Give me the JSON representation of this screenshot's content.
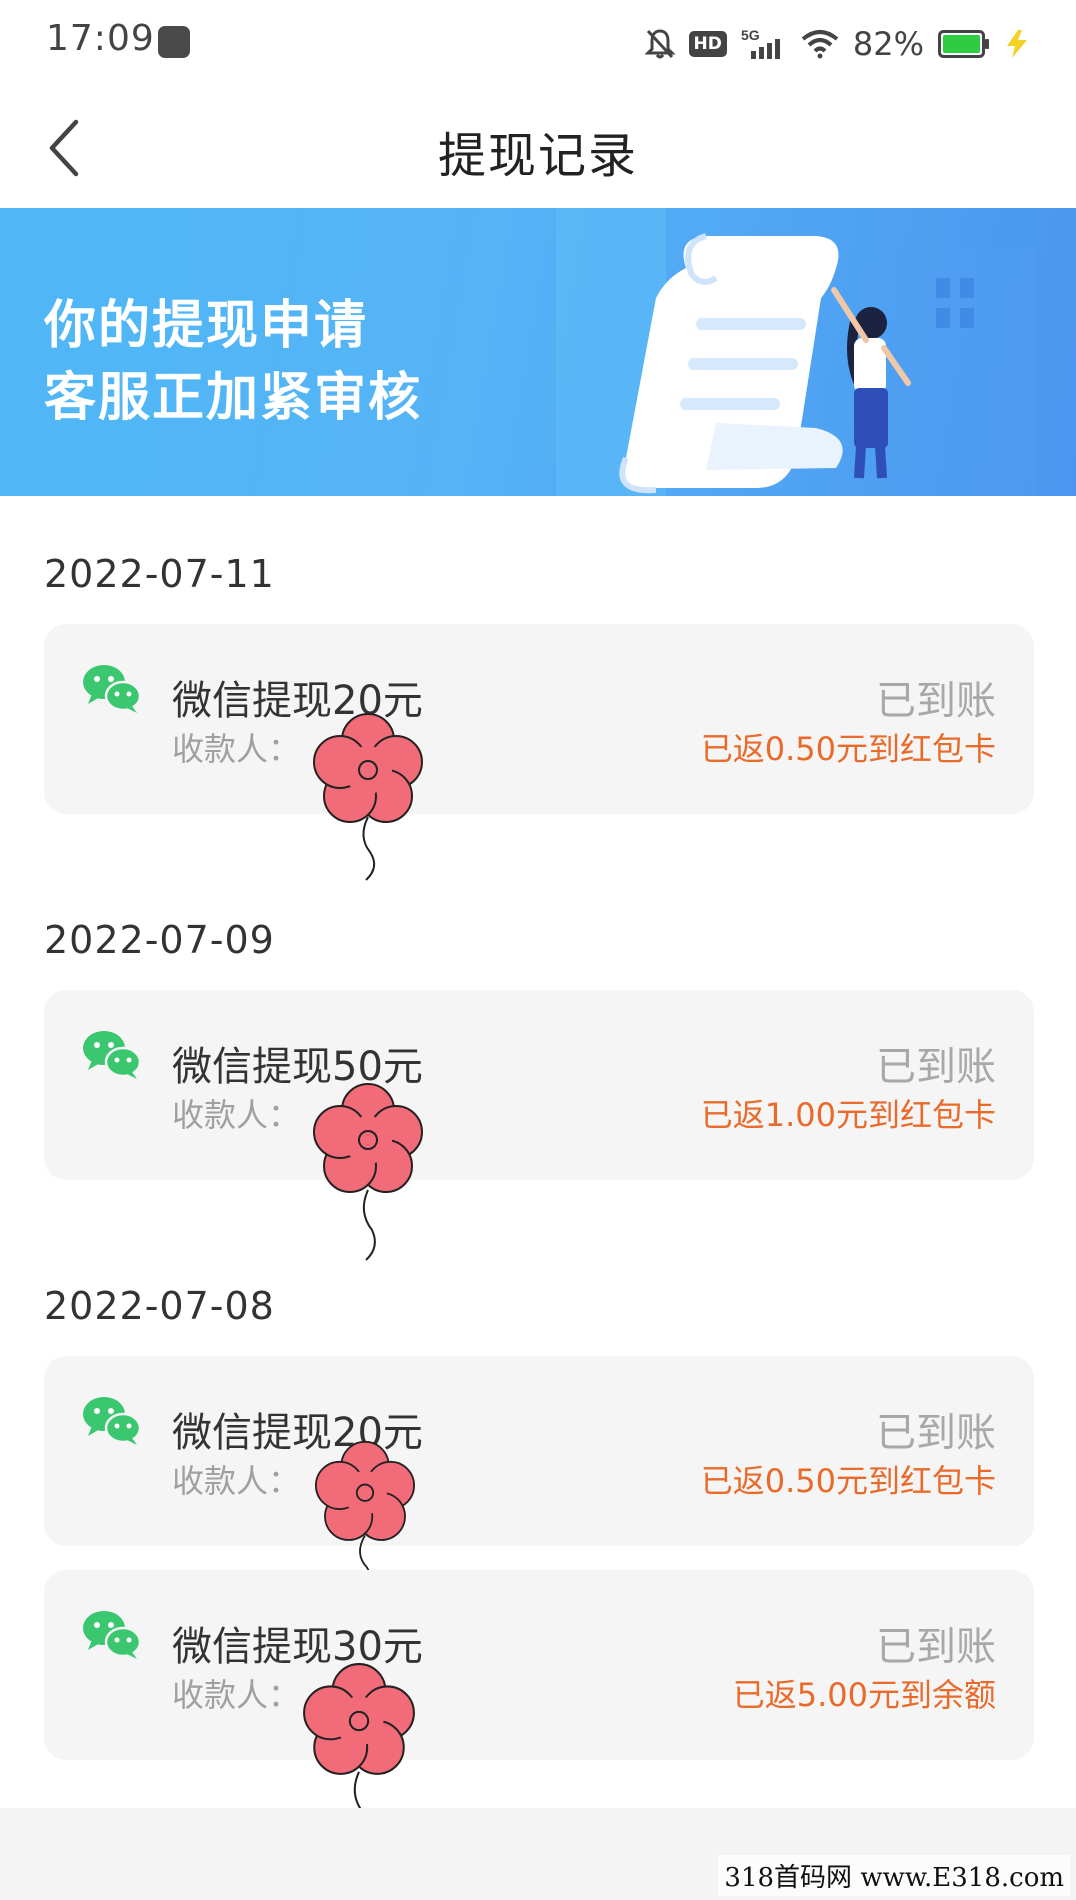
{
  "status_bar": {
    "time": "17:09",
    "network": "5G",
    "hd": "HD",
    "battery_pct": "82%",
    "battery_color": "#2ecc40",
    "icons": [
      "screen-record-icon",
      "mute-icon",
      "hd-icon",
      "signal-5g-icon",
      "wifi-icon",
      "battery-icon",
      "charging-icon"
    ]
  },
  "header": {
    "title": "提现记录",
    "back_icon": "chevron-left-icon"
  },
  "banner": {
    "line1": "你的提现申请",
    "line2": "客服正加紧审核",
    "colors": [
      "#4fb7f5",
      "#4b95f0"
    ]
  },
  "groups": [
    {
      "date": "2022-07-11",
      "records": [
        {
          "title": "微信提现20元",
          "payee_label": "收款人：",
          "status": "已到账",
          "rebate": "已返0.50元到红包卡"
        }
      ]
    },
    {
      "date": "2022-07-09",
      "records": [
        {
          "title": "微信提现50元",
          "payee_label": "收款人：",
          "status": "已到账",
          "rebate": "已返1.00元到红包卡"
        }
      ]
    },
    {
      "date": "2022-07-08",
      "records": [
        {
          "title": "微信提现20元",
          "payee_label": "收款人：",
          "status": "已到账",
          "rebate": "已返0.50元到红包卡"
        },
        {
          "title": "微信提现30元",
          "payee_label": "收款人：",
          "status": "已到账",
          "rebate": "已返5.00元到余额"
        }
      ]
    }
  ],
  "colors": {
    "wechat_green": "#3bc670",
    "rebate_orange": "#ea6a2a",
    "flower_pink": "#f26b78"
  },
  "watermark": "318首码网 www.E318.com"
}
